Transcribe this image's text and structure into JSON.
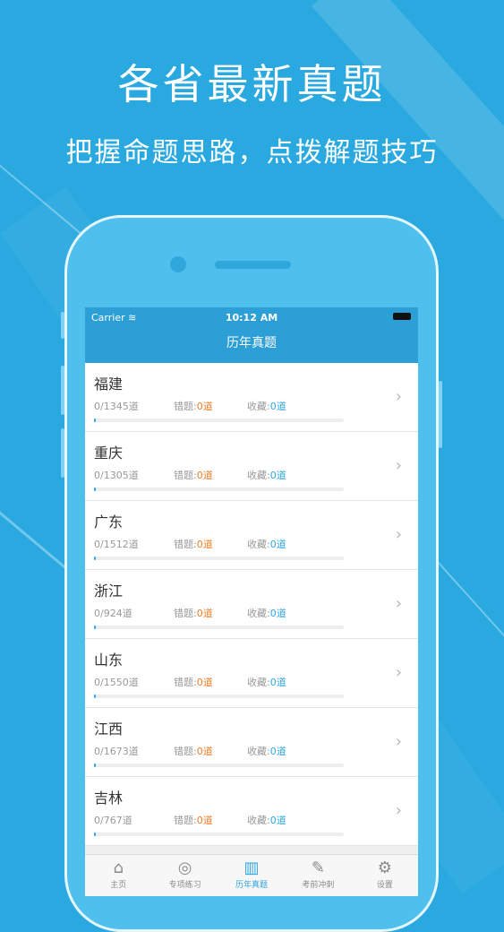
{
  "promo": {
    "headline": "各省最新真题",
    "subline": "把握命题思路，点拨解题技巧"
  },
  "status_bar": {
    "carrier": "Carrier",
    "time": "10:12 AM"
  },
  "nav": {
    "title": "历年真题"
  },
  "labels": {
    "wrong": "错题:",
    "favorite": "收藏:"
  },
  "provinces": [
    {
      "name": "福建",
      "progress": "0/1345道",
      "wrong": "0道",
      "favorite": "0道",
      "done_fraction": 0
    },
    {
      "name": "重庆",
      "progress": "0/1305道",
      "wrong": "0道",
      "favorite": "0道",
      "done_fraction": 0
    },
    {
      "name": "广东",
      "progress": "0/1512道",
      "wrong": "0道",
      "favorite": "0道",
      "done_fraction": 0
    },
    {
      "name": "浙江",
      "progress": "0/924道",
      "wrong": "0道",
      "favorite": "0道",
      "done_fraction": 0
    },
    {
      "name": "山东",
      "progress": "0/1550道",
      "wrong": "0道",
      "favorite": "0道",
      "done_fraction": 0
    },
    {
      "name": "江西",
      "progress": "0/1673道",
      "wrong": "0道",
      "favorite": "0道",
      "done_fraction": 0
    },
    {
      "name": "吉林",
      "progress": "0/767道",
      "wrong": "0道",
      "favorite": "0道",
      "done_fraction": 0
    }
  ],
  "tabs": [
    {
      "label": "主页",
      "icon": "home-icon",
      "active": false
    },
    {
      "label": "专项练习",
      "icon": "target-icon",
      "active": false
    },
    {
      "label": "历年真题",
      "icon": "binders-icon",
      "active": true
    },
    {
      "label": "考前冲刺",
      "icon": "notepad-icon",
      "active": false
    },
    {
      "label": "设置",
      "icon": "gear-icon",
      "active": false
    }
  ],
  "colors": {
    "accent": "#2ea6e0",
    "wrong": "#ef7d26",
    "background": "#29a9e0"
  }
}
